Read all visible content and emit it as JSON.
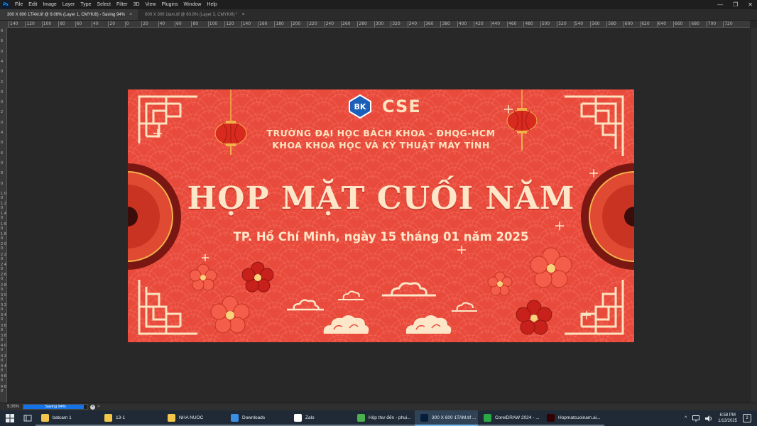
{
  "app": {
    "logo_text": "Ps"
  },
  "menu": [
    "File",
    "Edit",
    "Image",
    "Layer",
    "Type",
    "Select",
    "Filter",
    "3D",
    "View",
    "Plugins",
    "Window",
    "Help"
  ],
  "window_controls": {
    "minimize": "—",
    "restore": "❐",
    "close": "✕"
  },
  "tabs": [
    {
      "label": "300 X 600 1TAM.tif @ 9.06% (Layer 1, CMYK/8) - Saving 94%",
      "close": "×"
    },
    {
      "label": "600 X 300 1tam.tif @ 60.8% (Layer 3, CMYK/8) *",
      "close": "×"
    }
  ],
  "ruler_h": [
    "140",
    "120",
    "100",
    "80",
    "60",
    "40",
    "20",
    "0",
    "20",
    "40",
    "60",
    "80",
    "100",
    "120",
    "140",
    "160",
    "180",
    "200",
    "220",
    "240",
    "260",
    "280",
    "300",
    "320",
    "340",
    "360",
    "380",
    "400",
    "420",
    "440",
    "460",
    "480",
    "500",
    "520",
    "540",
    "560",
    "580",
    "600",
    "620",
    "640",
    "660",
    "680",
    "700",
    "720"
  ],
  "ruler_v": [
    "0",
    "6",
    "0",
    "4",
    "0",
    "2",
    "0",
    "0",
    "2",
    "0",
    "4",
    "0",
    "6",
    "0",
    "8",
    "0",
    "1 0 0",
    "1 2 0",
    "1 4 0",
    "1 6 0",
    "1 8 0",
    "2 0 0",
    "2 2 0",
    "2 4 0",
    "2 6 0",
    "2 8 0",
    "3 0 0",
    "3 2 0",
    "3 4 0",
    "3 6 0",
    "3 8 0",
    "4 0 0",
    "4 2 0",
    "4 4 0",
    "4 6 0",
    "4 8 0"
  ],
  "banner": {
    "logo_badge": "BK",
    "brand": "CSE",
    "university": "TRƯỜNG ĐẠI HỌC BÁCH KHOA - ĐHQG-HCM",
    "faculty": "KHOA KHOA HỌC VÀ KỸ THUẬT MÁY TÍNH",
    "title": "HỌP MẶT CUỐI NĂM",
    "date_line": "TP. Hồ Chí Minh, ngày 15 tháng 01 năm 2025",
    "colors": {
      "background": "#e84a3c",
      "text": "#fde7c8",
      "pattern": "#ff8c78"
    }
  },
  "status": {
    "zoom": "9.06%",
    "progress_label": "Saving 94%",
    "progress_value": 0.94,
    "cancel": "×",
    "arrow": ">"
  },
  "taskbar": {
    "items": [
      {
        "label": "batcam 1",
        "icon": "folder-icon",
        "color": "#f3c64a",
        "state": "open"
      },
      {
        "label": "13-1",
        "icon": "folder-icon",
        "color": "#f3c64a",
        "state": "open"
      },
      {
        "label": "NHA NUOC",
        "icon": "folder-icon",
        "color": "#f3c64a",
        "state": "open"
      },
      {
        "label": "Downloads",
        "icon": "download-icon",
        "color": "#3a8ee6",
        "state": "open"
      },
      {
        "label": "Zalo",
        "icon": "zalo-icon",
        "color": "#ffffff",
        "state": "open"
      },
      {
        "label": "Hộp thư đến - phui...",
        "icon": "chrome-icon",
        "color": "#4caf50",
        "state": "open"
      },
      {
        "label": "300 X 600 1TAM.tif ...",
        "icon": "photoshop-icon",
        "color": "#061e3c",
        "state": "active"
      },
      {
        "label": "CorelDRAW 2024 - ...",
        "icon": "coreldraw-icon",
        "color": "#2aa845",
        "state": "open"
      },
      {
        "label": "Hopmatcuoinam.ai...",
        "icon": "illustrator-icon",
        "color": "#330000",
        "state": "open"
      }
    ],
    "tray": {
      "chevron": "^",
      "time": "6:58 PM",
      "date": "1/13/2025",
      "notifications": "2"
    }
  }
}
